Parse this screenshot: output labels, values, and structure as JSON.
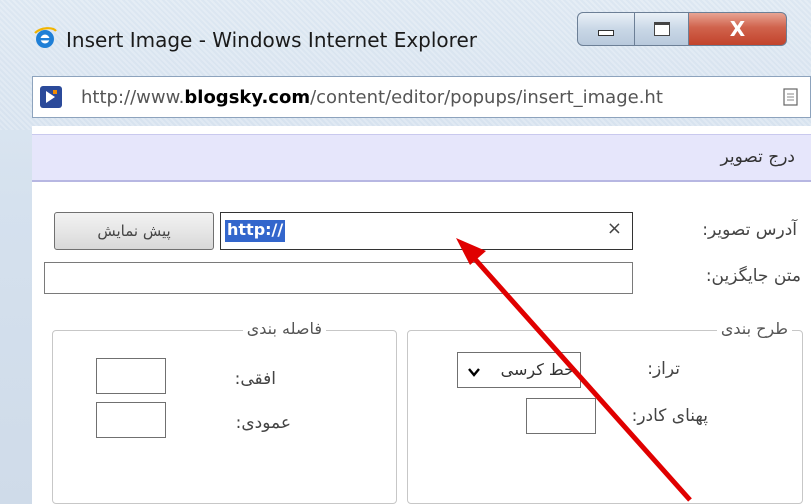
{
  "window": {
    "title": "Insert Image - Windows Internet Explorer",
    "controls": {
      "minimize": "minimize",
      "maximize": "maximize",
      "close": "X"
    }
  },
  "address_bar": {
    "prefix": "http://www.",
    "host": "blogsky.com",
    "path": "/content/editor/popups/insert_image.ht"
  },
  "dialog": {
    "title": "درج تصویر",
    "image_address_label": "آدرس تصویر:",
    "image_address_value": "http://",
    "clear_symbol": "×",
    "preview_button": "پیش نمایش",
    "alt_text_label": "متن جایگزین:",
    "alt_text_value": "",
    "layout_group": {
      "title": "طرح بندی",
      "align_label": "تراز:",
      "align_value": "خط کرسی",
      "border_width_label": "پهنای کادر:",
      "border_width_value": ""
    },
    "spacing_group": {
      "title": "فاصله بندی",
      "horizontal_label": "افقی:",
      "horizontal_value": "",
      "vertical_label": "عمودی:",
      "vertical_value": ""
    }
  },
  "annotation": {
    "arrow_color": "#e00000"
  },
  "colors": {
    "header_strip": "#e6e6fb",
    "selection": "#3366cc",
    "close_button": "#c9503a"
  },
  "icons": [
    "ie-logo-icon",
    "page-icon",
    "minimize-icon",
    "maximize-icon",
    "close-icon",
    "chevron-down-icon"
  ]
}
